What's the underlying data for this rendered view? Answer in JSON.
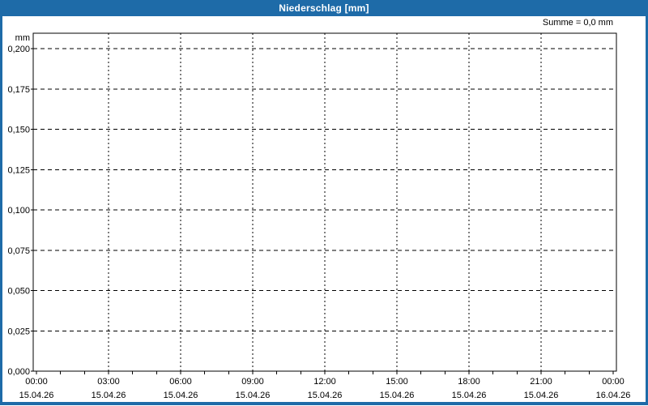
{
  "window": {
    "title": "Niederschlag [mm]",
    "colors": {
      "titlebar_bg": "#1e6ba8",
      "titlebar_text": "#ffffff",
      "window_border": "#1e6ba8",
      "content_bg": "#ffffff",
      "axis_line": "#000000",
      "grid_line": "#000000",
      "label_text": "#000000"
    }
  },
  "summary": {
    "text": "Summe = 0,0 mm"
  },
  "chart_data": {
    "type": "line",
    "title": "Niederschlag [mm]",
    "ylabel_unit": "mm",
    "summary_annotation": "Summe = 0,0 mm",
    "grid": true,
    "legend_position": "none",
    "ylim": [
      0.0,
      0.21
    ],
    "x_range_hours": [
      0,
      24
    ],
    "x_minor_tick_every_hours": 1,
    "x_major_tick_every_hours": 3,
    "y_ticks": [
      {
        "value": 0.2,
        "label": "0,200"
      },
      {
        "value": 0.175,
        "label": "0,175"
      },
      {
        "value": 0.15,
        "label": "0,150"
      },
      {
        "value": 0.125,
        "label": "0,125"
      },
      {
        "value": 0.1,
        "label": "0,100"
      },
      {
        "value": 0.075,
        "label": "0,075"
      },
      {
        "value": 0.05,
        "label": "0,050"
      },
      {
        "value": 0.025,
        "label": "0,025"
      },
      {
        "value": 0.0,
        "label": "0,000"
      }
    ],
    "x_ticks": [
      {
        "hour": 0,
        "time": "00:00",
        "date": "15.04.26"
      },
      {
        "hour": 3,
        "time": "03:00",
        "date": "15.04.26"
      },
      {
        "hour": 6,
        "time": "06:00",
        "date": "15.04.26"
      },
      {
        "hour": 9,
        "time": "09:00",
        "date": "15.04.26"
      },
      {
        "hour": 12,
        "time": "12:00",
        "date": "15.04.26"
      },
      {
        "hour": 15,
        "time": "15:00",
        "date": "15.04.26"
      },
      {
        "hour": 18,
        "time": "18:00",
        "date": "15.04.26"
      },
      {
        "hour": 21,
        "time": "21:00",
        "date": "15.04.26"
      },
      {
        "hour": 24,
        "time": "00:00",
        "date": "16.04.26"
      }
    ],
    "series": [
      {
        "name": "Niederschlag",
        "values": [],
        "total_mm": 0.0
      }
    ]
  }
}
